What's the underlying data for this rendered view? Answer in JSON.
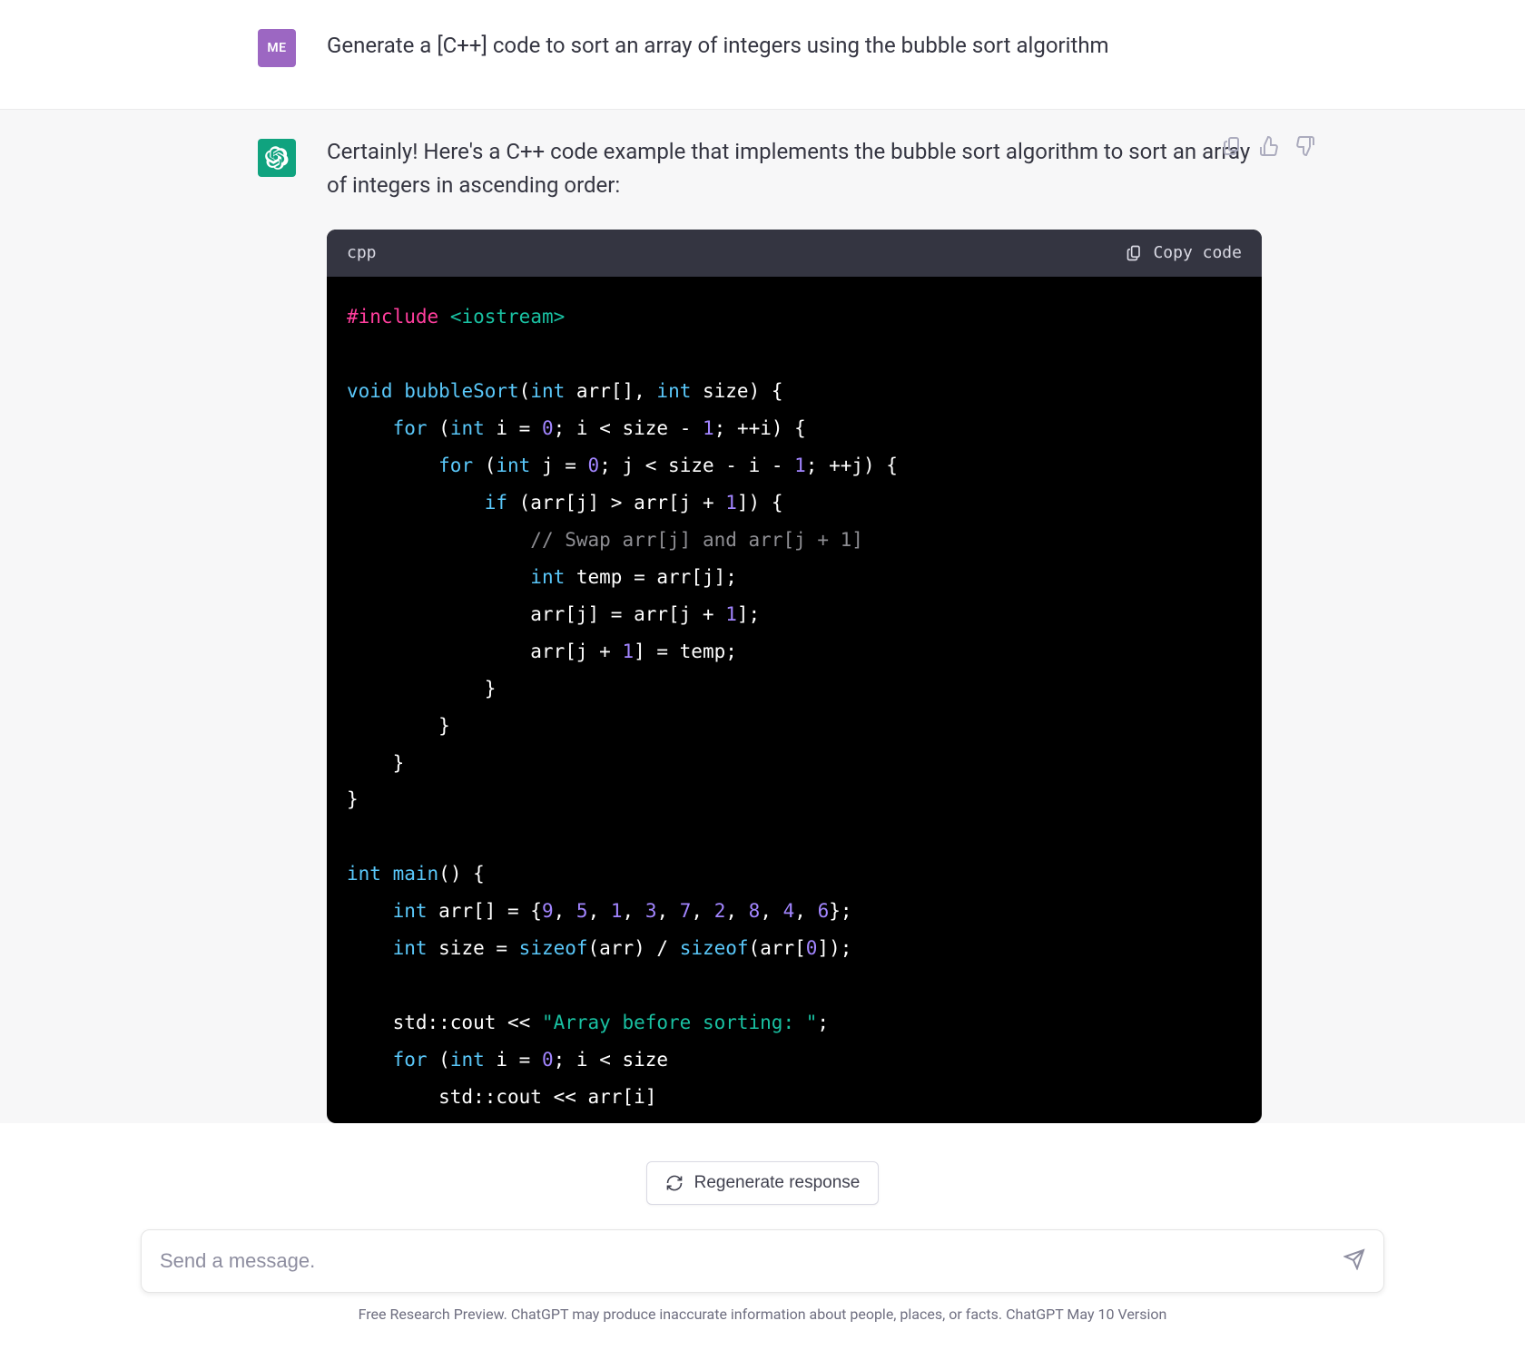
{
  "user": {
    "avatar_label": "ME",
    "message": "Generate a [C++] code to sort an array of integers using the bubble sort algorithm"
  },
  "assistant": {
    "intro": "Certainly! Here's a C++ code example that implements the bubble sort algorithm to sort an array of integers in ascending order:",
    "code_lang": "cpp",
    "copy_label": "Copy code",
    "code_plain": "#include <iostream>\n\nvoid bubbleSort(int arr[], int size) {\n    for (int i = 0; i < size - 1; ++i) {\n        for (int j = 0; j < size - i - 1; ++j) {\n            if (arr[j] > arr[j + 1]) {\n                // Swap arr[j] and arr[j + 1]\n                int temp = arr[j];\n                arr[j] = arr[j + 1];\n                arr[j + 1] = temp;\n            }\n        }\n    }\n}\n\nint main() {\n    int arr[] = {9, 5, 1, 3, 7, 2, 8, 4, 6};\n    int size = sizeof(arr) / sizeof(arr[0]);\n\n    std::cout << \"Array before sorting: \";\n    for (int i = 0; i < size\n        std::cout << arr[i]"
  },
  "regenerate_label": "Regenerate response",
  "composer": {
    "placeholder": "Send a message."
  },
  "footer": "Free Research Preview. ChatGPT may produce inaccurate information about people, places, or facts. ChatGPT May 10 Version"
}
